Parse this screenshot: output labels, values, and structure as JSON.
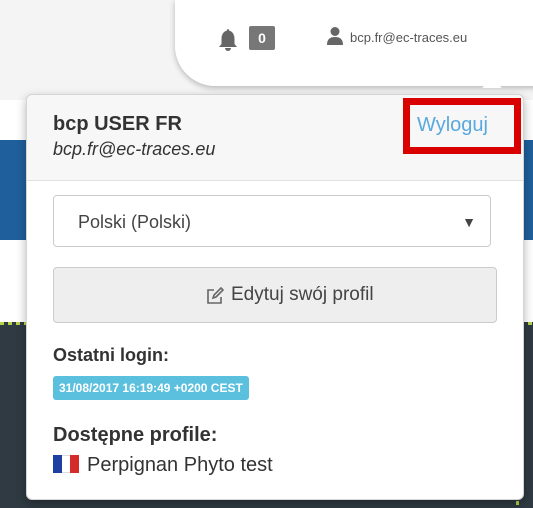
{
  "navbar": {
    "notifications_count": "0",
    "user_email": "bcp.fr@ec-traces.eu",
    "icons": {
      "notifications": "bell-icon",
      "user": "user-icon"
    }
  },
  "dropdown": {
    "user_name": "bcp USER FR",
    "user_email": "bcp.fr@ec-traces.eu",
    "logout_label": "Wyloguj",
    "language": {
      "selected": "Polski (Polski)"
    },
    "edit_profile_label": "Edytuj swój profil",
    "last_login_label": "Ostatni login:",
    "last_login_value": "31/08/2017 16:19:49 +0200 CEST",
    "profiles_label": "Dostępne profile:",
    "profiles": [
      {
        "name": "Perpignan Phyto test",
        "flag_colors": [
          "#1f3fa3",
          "#ffffff",
          "#d52b2b"
        ]
      }
    ]
  },
  "colors": {
    "highlight_box": "#d90000",
    "link": "#5aa9dd",
    "badge_info": "#5bc0de"
  }
}
